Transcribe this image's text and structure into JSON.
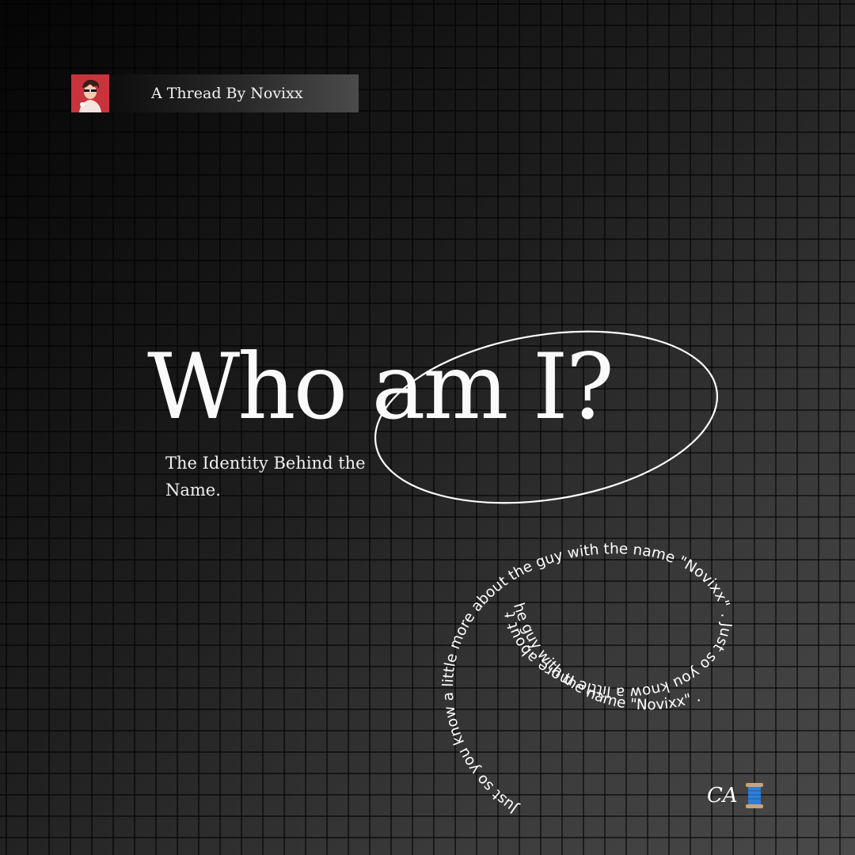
{
  "header": {
    "label": "A Thread By Novixx",
    "avatar_icon": "avatar-portrait"
  },
  "hero": {
    "title": "Who am I?",
    "subtitle": "The Identity Behind the Name."
  },
  "spiral": {
    "text": "Just so you know a little more about the guy with the name \"Novixx\" . Just so you know a little more about the guy with the name \"Novixx\" ."
  },
  "signature": {
    "initials": "CA",
    "icon": "spool-of-thread-icon"
  },
  "colors": {
    "accent": "#ffffff",
    "avatar_bg": "#c8343c",
    "background_dark": "#050505",
    "background_light": "#4a4a4a"
  }
}
